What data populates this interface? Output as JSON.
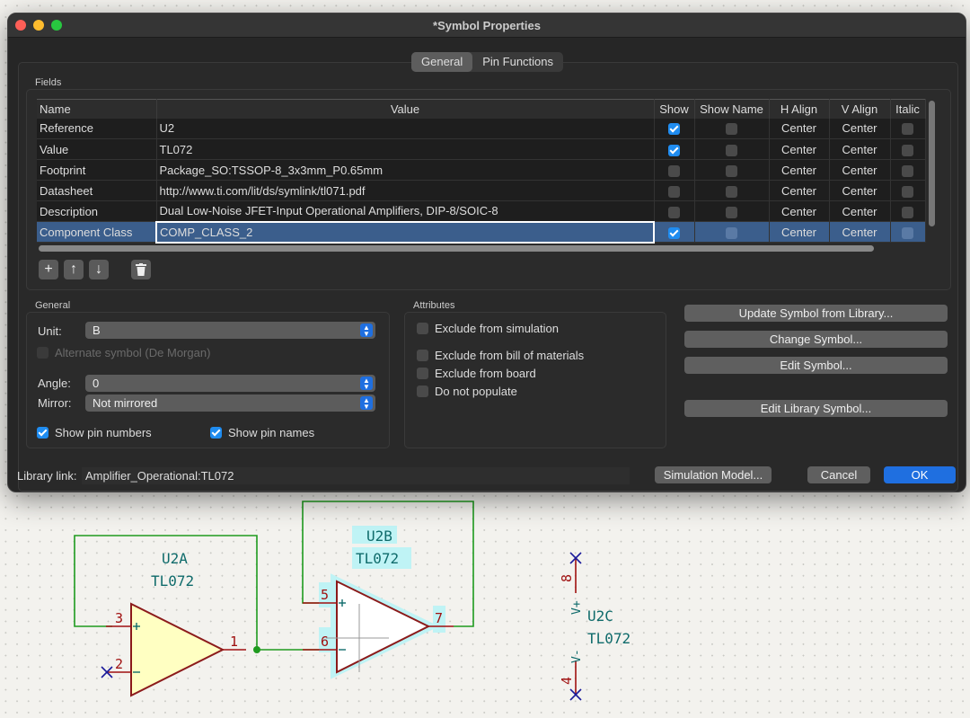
{
  "window": {
    "title": "*Symbol Properties"
  },
  "tabs": [
    {
      "label": "General",
      "active": true
    },
    {
      "label": "Pin Functions",
      "active": false
    }
  ],
  "fields": {
    "group_label": "Fields",
    "columns": [
      "Name",
      "Value",
      "Show",
      "Show Name",
      "H Align",
      "V Align",
      "Italic"
    ],
    "rows": [
      {
        "name": "Reference",
        "value": "U2",
        "show": true,
        "show_name": false,
        "h_align": "Center",
        "v_align": "Center",
        "italic": false
      },
      {
        "name": "Value",
        "value": "TL072",
        "show": true,
        "show_name": false,
        "h_align": "Center",
        "v_align": "Center",
        "italic": false
      },
      {
        "name": "Footprint",
        "value": "Package_SO:TSSOP-8_3x3mm_P0.65mm",
        "show": false,
        "show_name": false,
        "h_align": "Center",
        "v_align": "Center",
        "italic": false
      },
      {
        "name": "Datasheet",
        "value": "http://www.ti.com/lit/ds/symlink/tl071.pdf",
        "show": false,
        "show_name": false,
        "h_align": "Center",
        "v_align": "Center",
        "italic": false
      },
      {
        "name": "Description",
        "value": "Dual Low-Noise JFET-Input Operational Amplifiers, DIP-8/SOIC-8",
        "show": false,
        "show_name": false,
        "h_align": "Center",
        "v_align": "Center",
        "italic": false
      },
      {
        "name": "Component Class",
        "value": "COMP_CLASS_2",
        "show": true,
        "show_name": false,
        "h_align": "Center",
        "v_align": "Center",
        "italic": false,
        "selected": true
      }
    ],
    "toolbar_icons": [
      "plus-icon",
      "arrow-up-icon",
      "arrow-down-icon",
      "trash-icon"
    ]
  },
  "general": {
    "group_label": "General",
    "unit_label": "Unit:",
    "unit_value": "B",
    "alternate_label": "Alternate symbol (De Morgan)",
    "alternate_checked": false,
    "angle_label": "Angle:",
    "angle_value": "0",
    "mirror_label": "Mirror:",
    "mirror_value": "Not mirrored",
    "show_pin_numbers_label": "Show pin numbers",
    "show_pin_numbers": true,
    "show_pin_names_label": "Show pin names",
    "show_pin_names": true
  },
  "attributes": {
    "group_label": "Attributes",
    "items": [
      {
        "label": "Exclude from simulation",
        "checked": false
      },
      {
        "label": "Exclude from bill of materials",
        "checked": false
      },
      {
        "label": "Exclude from board",
        "checked": false
      },
      {
        "label": "Do not populate",
        "checked": false
      }
    ]
  },
  "actions": [
    "Update Symbol from Library...",
    "Change Symbol...",
    "Edit Symbol...",
    "Edit Library Symbol..."
  ],
  "footer": {
    "library_link_label": "Library link:",
    "library_link_value": "Amplifier_Operational:TL072",
    "simulation_button": "Simulation Model...",
    "cancel_button": "Cancel",
    "ok_button": "OK"
  },
  "schematic": {
    "u2a": {
      "ref": "U2A",
      "value": "TL072",
      "pins": [
        "3",
        "2",
        "1"
      ]
    },
    "u2b": {
      "ref": "U2B",
      "value": "TL072",
      "pins": [
        "5",
        "6",
        "7"
      ]
    },
    "u2c": {
      "ref": "U2C",
      "value": "TL072",
      "pins": [
        "8",
        "4"
      ],
      "pin_names": [
        "V+",
        "V-"
      ]
    },
    "colors": {
      "wire": "#1f9a1f",
      "pin": "#a01010",
      "ref": "#0f6b6b",
      "highlight": "#bff3f5",
      "opamp_fill": "#ffffc2",
      "noconnect": "#1a1a9a"
    }
  },
  "colors": {
    "accent": "#1f8cf0",
    "selected_row": "#3b5e8c"
  }
}
